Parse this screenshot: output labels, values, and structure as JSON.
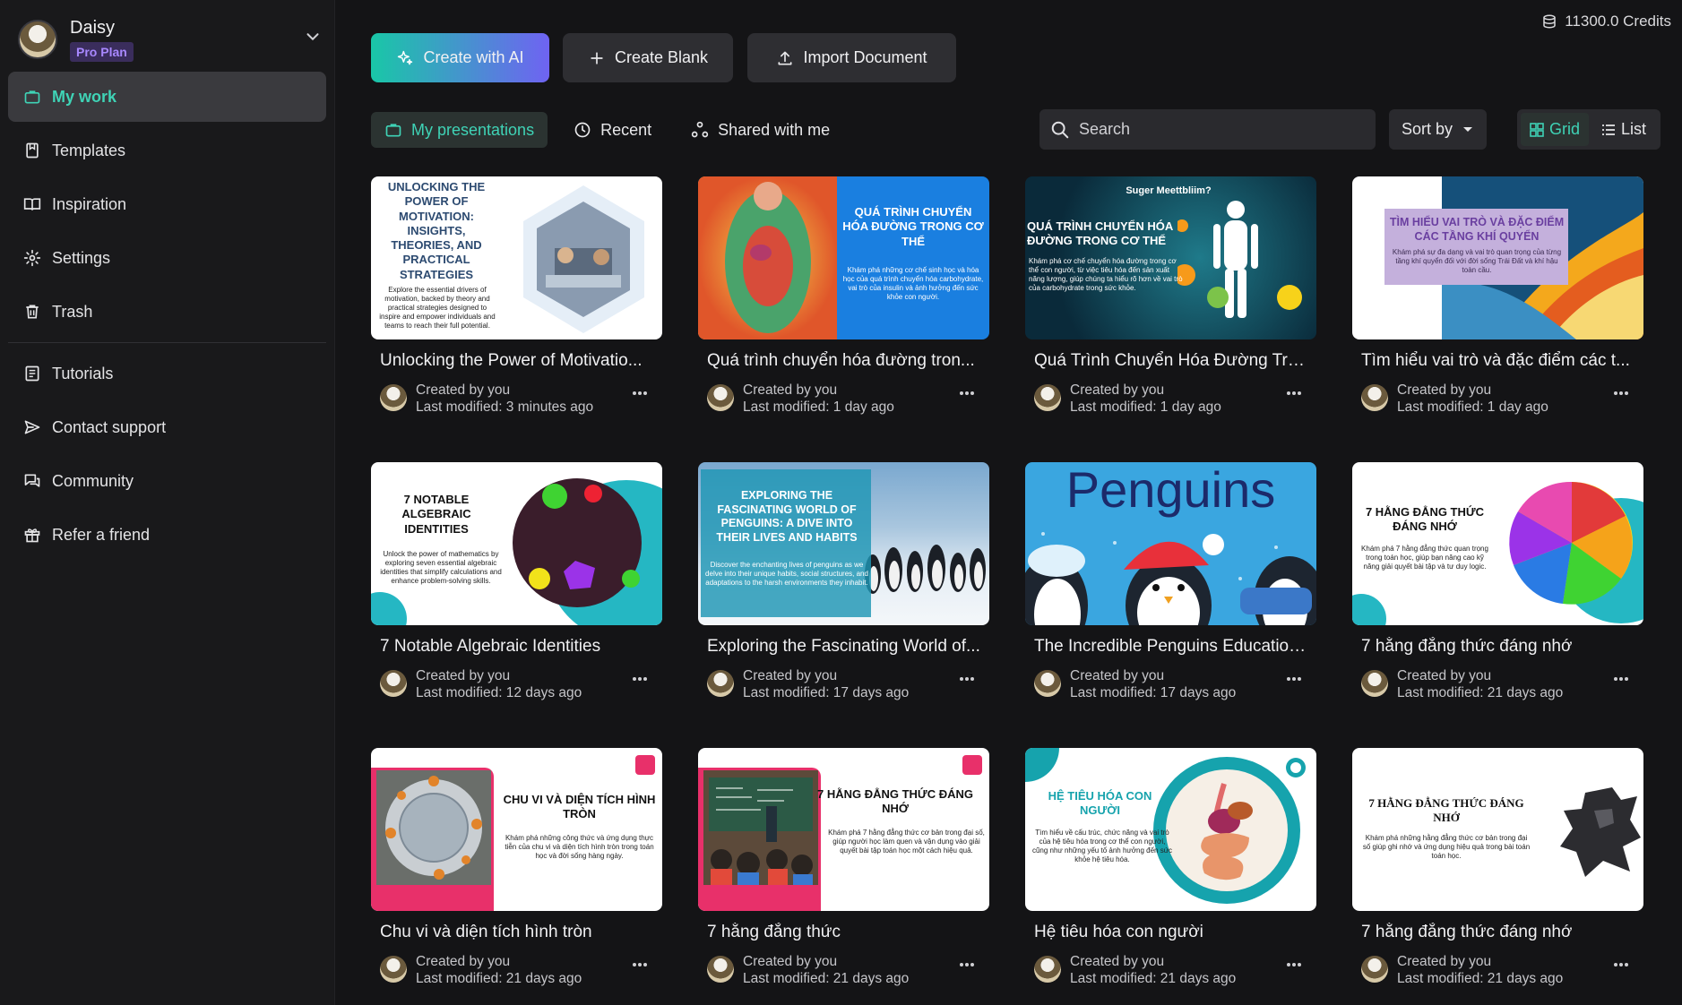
{
  "user": {
    "name": "Daisy",
    "plan": "Pro Plan"
  },
  "credits": "11300.0 Credits",
  "nav": [
    {
      "label": "My work",
      "icon": "briefcase-icon"
    },
    {
      "label": "Templates",
      "icon": "template-icon"
    },
    {
      "label": "Inspiration",
      "icon": "book-icon"
    },
    {
      "label": "Settings",
      "icon": "gear-icon"
    },
    {
      "label": "Trash",
      "icon": "trash-icon"
    }
  ],
  "nav2": [
    {
      "label": "Tutorials",
      "icon": "document-icon"
    },
    {
      "label": "Contact support",
      "icon": "send-icon"
    },
    {
      "label": "Community",
      "icon": "chat-icon"
    },
    {
      "label": "Refer a friend",
      "icon": "gift-icon"
    }
  ],
  "actions": {
    "create_ai": "Create with AI",
    "create_blank": "Create Blank",
    "import": "Import Document"
  },
  "tabs": {
    "my": "My presentations",
    "recent": "Recent",
    "shared": "Shared with me"
  },
  "search": {
    "placeholder": "Search"
  },
  "sort": {
    "label": "Sort by"
  },
  "view": {
    "grid": "Grid",
    "list": "List"
  },
  "colors": {
    "accent": "#3fd3b6",
    "plan": "#a888ff"
  },
  "cards": [
    {
      "title": "Unlocking the Power of Motivatio...",
      "creator": "Created by you",
      "modified": "Last modified: 3 minutes ago",
      "thumb_title": "UNLOCKING THE POWER OF MOTIVATION: INSIGHTS, THEORIES, AND PRACTICAL STRATEGIES",
      "thumb_sub": "Explore the essential drivers of motivation, backed by theory and practical strategies designed to inspire and empower individuals and teams to reach their full potential."
    },
    {
      "title": "Quá trình chuyển hóa đường tron...",
      "creator": "Created by you",
      "modified": "Last modified: 1 day ago",
      "thumb_title": "QUÁ TRÌNH CHUYỂN HÓA ĐƯỜNG TRONG CƠ THỂ",
      "thumb_sub": "Khám phá những cơ chế sinh học và hóa học của quá trình chuyển hóa carbohydrate, vai trò của insulin và ảnh hưởng đến sức khỏe con người."
    },
    {
      "title": "Quá Trình Chuyển Hóa Đường Tro...",
      "creator": "Created by you",
      "modified": "Last modified: 1 day ago",
      "thumb_top": "Suger Meettbliim?",
      "thumb_title": "QUÁ TRÌNH CHUYỂN HÓA ĐƯỜNG TRONG CƠ THỂ",
      "thumb_sub": "Khám phá cơ chế chuyển hóa đường trong cơ thể con người, từ việc tiêu hóa đến sản xuất năng lượng, giúp chúng ta hiểu rõ hơn về vai trò của carbohydrate trong sức khỏe."
    },
    {
      "title": "Tìm hiểu vai trò và đặc điểm các t...",
      "creator": "Created by you",
      "modified": "Last modified: 1 day ago",
      "thumb_title": "TÌM HIỂU VAI TRÒ VÀ ĐẶC ĐIỂM CÁC TẦNG KHÍ QUYỂN",
      "thumb_sub": "Khám phá sự đa dạng và vai trò quan trọng của từng tầng khí quyển đối với đời sống Trái Đất và khí hậu toàn cầu."
    },
    {
      "title": "7 Notable Algebraic Identities",
      "creator": "Created by you",
      "modified": "Last modified: 12 days ago",
      "thumb_title": "7 NOTABLE ALGEBRAIC IDENTITIES",
      "thumb_sub": "Unlock the power of mathematics by exploring seven essential algebraic identities that simplify calculations and enhance problem-solving skills."
    },
    {
      "title": "Exploring the Fascinating World of...",
      "creator": "Created by you",
      "modified": "Last modified: 17 days ago",
      "thumb_title": "EXPLORING THE FASCINATING WORLD OF PENGUINS: A DIVE INTO THEIR LIVES AND HABITS",
      "thumb_sub": "Discover the enchanting lives of penguins as we delve into their unique habits, social structures, and adaptations to the harsh environments they inhabit."
    },
    {
      "title": "The Incredible Penguins Education...",
      "creator": "Created by you",
      "modified": "Last modified: 17 days ago",
      "thumb_title": "Penguins"
    },
    {
      "title": "7 hằng đẳng thức đáng nhớ",
      "creator": "Created by you",
      "modified": "Last modified: 21 days ago",
      "thumb_title": "7 HẰNG ĐẲNG THỨC ĐÁNG NHỚ",
      "thumb_sub": "Khám phá 7 hằng đẳng thức quan trọng trong toán học, giúp bạn nâng cao kỹ năng giải quyết bài tập và tư duy logic."
    },
    {
      "title": "Chu vi và diện tích hình tròn",
      "creator": "Created by you",
      "modified": "Last modified: 21 days ago",
      "thumb_title": "CHU VI VÀ DIỆN TÍCH HÌNH TRÒN",
      "thumb_sub": "Khám phá những công thức và ứng dụng thực tiễn của chu vi và diện tích hình tròn trong toán học và đời sống hàng ngày."
    },
    {
      "title": "7 hằng đẳng thức",
      "creator": "Created by you",
      "modified": "Last modified: 21 days ago",
      "thumb_title": "7 HẰNG ĐẲNG THỨC ĐÁNG NHỚ",
      "thumb_sub": "Khám phá 7 hằng đẳng thức cơ bản trong đại số, giúp người học làm quen và vận dụng vào giải quyết bài tập toán học một cách hiệu quả."
    },
    {
      "title": "Hệ tiêu hóa con người",
      "creator": "Created by you",
      "modified": "Last modified: 21 days ago",
      "thumb_title": "HỆ TIÊU HÓA CON NGƯỜI",
      "thumb_sub": "Tìm hiểu về cấu trúc, chức năng và vai trò của hệ tiêu hóa trong cơ thể con người, cũng như những yếu tố ảnh hưởng đến sức khỏe hệ tiêu hóa."
    },
    {
      "title": "7 hằng đẳng thức đáng nhớ",
      "creator": "Created by you",
      "modified": "Last modified: 21 days ago",
      "thumb_title": "7 HẰNG ĐẲNG THỨC ĐÁNG NHỚ",
      "thumb_sub": "Khám phá những hằng đẳng thức cơ bản trong đại số giúp ghi nhớ và ứng dụng hiệu quả trong bài toán toán học."
    }
  ]
}
